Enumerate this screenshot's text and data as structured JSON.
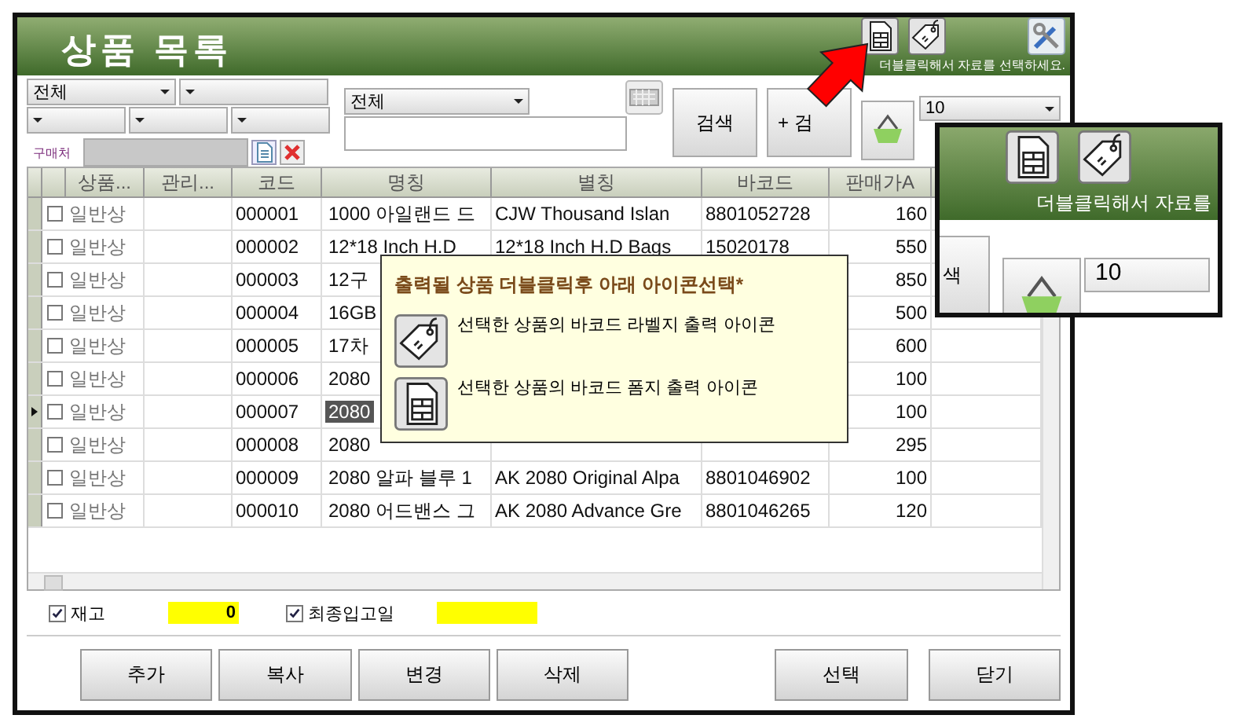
{
  "window": {
    "title": "상품 목록",
    "hint": "더블클릭해서 자료를 선택하세요."
  },
  "filters": {
    "first_select": "전체",
    "supplier_label": "구매처",
    "scope": "전체",
    "search_button": "검색",
    "add_button": "+ 검",
    "count": "10"
  },
  "table": {
    "columns": [
      "상품...",
      "관리...",
      "코드",
      "명칭",
      "별칭",
      "바코드",
      "판매가A"
    ],
    "rows": [
      {
        "checked": false,
        "selected": false,
        "type": "일반상",
        "code": "000001",
        "name": "1000 아일랜드 드",
        "alias": "CJW Thousand Islan",
        "barcode": "8801052728",
        "price": "160"
      },
      {
        "checked": false,
        "selected": false,
        "type": "일반상",
        "code": "000002",
        "name": "12*18 Inch H.D",
        "alias": "12*18 Inch H.D Bags",
        "barcode": "15020178",
        "price": "550"
      },
      {
        "checked": false,
        "selected": false,
        "type": "일반상",
        "code": "000003",
        "name": "12구",
        "price": "850"
      },
      {
        "checked": false,
        "selected": false,
        "type": "일반상",
        "code": "000004",
        "name": "16GB",
        "price": "500"
      },
      {
        "checked": false,
        "selected": false,
        "type": "일반상",
        "code": "000005",
        "name": "17차",
        "price": "600"
      },
      {
        "checked": false,
        "selected": false,
        "type": "일반상",
        "code": "000006",
        "name": "2080",
        "price": "100"
      },
      {
        "checked": false,
        "selected": true,
        "type": "일반상",
        "code": "000007",
        "name": "2080",
        "price": "100"
      },
      {
        "checked": false,
        "selected": false,
        "type": "일반상",
        "code": "000008",
        "name": "2080",
        "price": "295"
      },
      {
        "checked": false,
        "selected": false,
        "type": "일반상",
        "code": "000009",
        "name": "2080 알파 블루 1",
        "alias": "AK 2080 Original Alpa",
        "barcode": "8801046902",
        "price": "100"
      },
      {
        "checked": false,
        "selected": false,
        "type": "일반상",
        "code": "000010",
        "name": "2080 어드밴스 그",
        "alias": "AK 2080 Advance Gre",
        "barcode": "8801046265",
        "price": "120"
      }
    ]
  },
  "totals": [
    {
      "label": "재고",
      "checked": true,
      "value": "0"
    },
    {
      "label": "최종입고일",
      "checked": true
    }
  ],
  "left_buttons": [
    "추가",
    "복사",
    "변경",
    "삭제"
  ],
  "right_buttons": [
    "선택",
    "닫기"
  ],
  "callout": {
    "title": "출력될 상품 더블클릭후 아래 아이콘선택*",
    "items": [
      {
        "kind": "tag",
        "text": "선택한 상품의 바코드 라벨지 출력 아이콘"
      },
      {
        "kind": "sheet",
        "text": "선택한 상품의 바코드 폼지 출력 아이콘"
      }
    ]
  },
  "inset": {
    "hint": "더블클릭해서 자료를",
    "button": "색",
    "count": "10"
  }
}
